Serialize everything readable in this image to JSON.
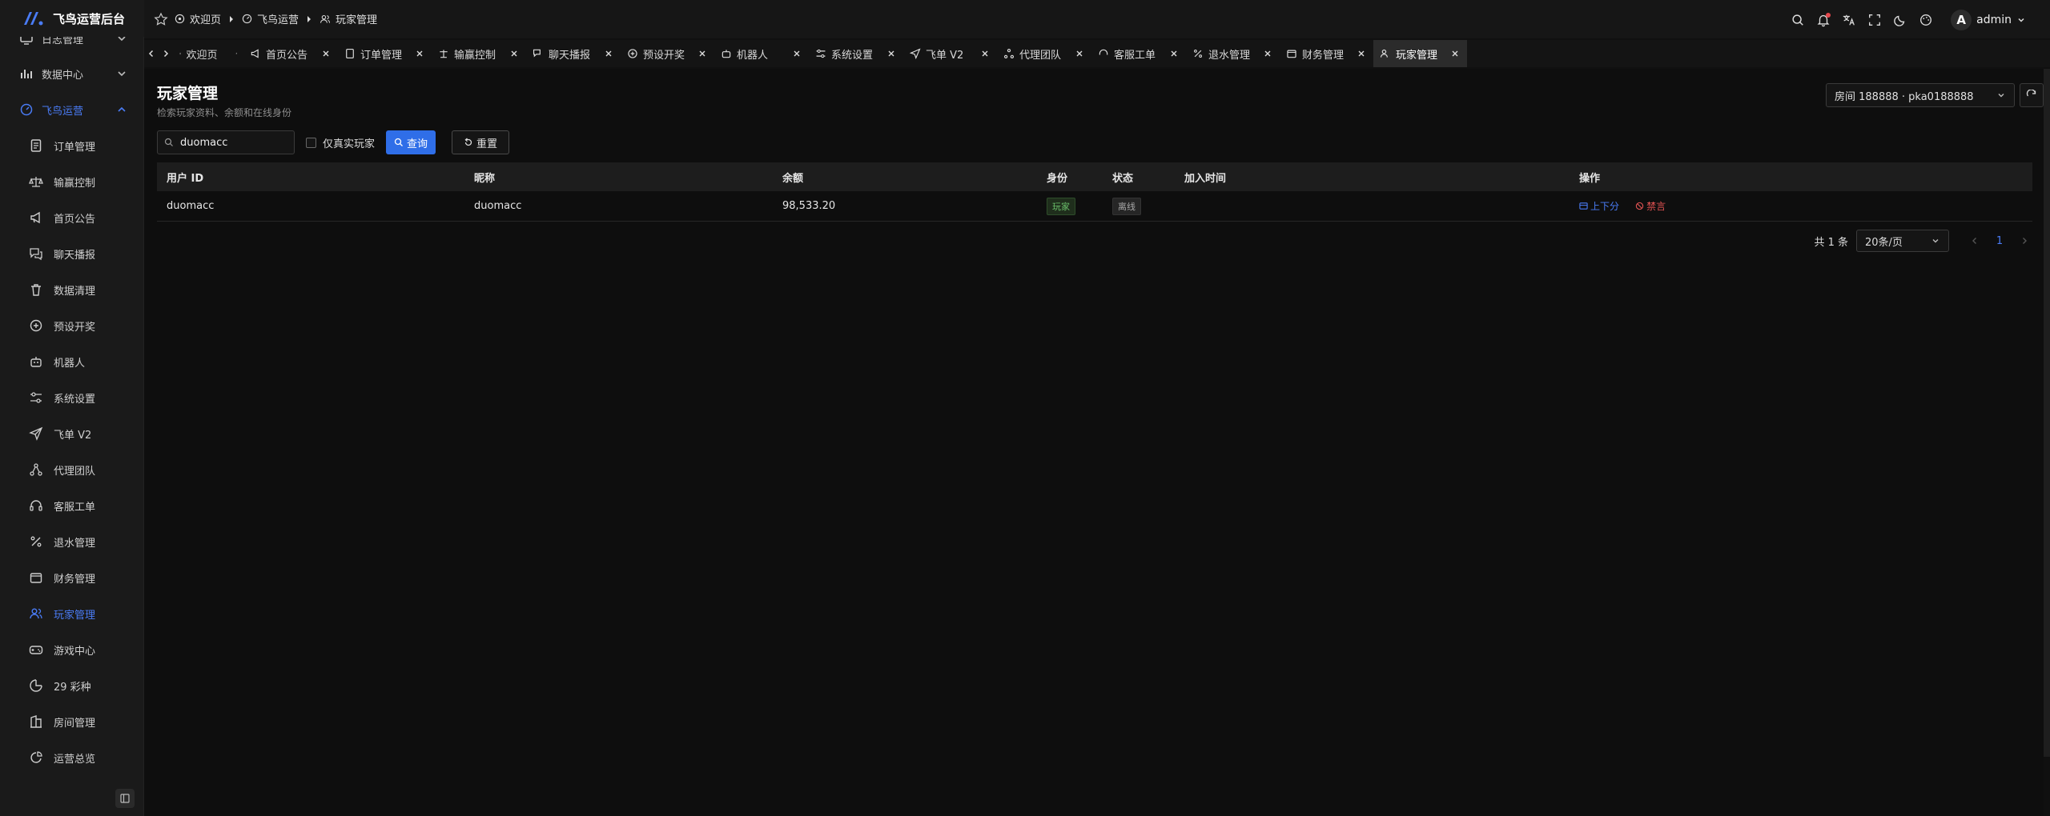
{
  "app": {
    "title": "飞鸟运营后台"
  },
  "sidebar": {
    "groups": [
      {
        "label": "日志管理",
        "icon": "monitor-icon"
      },
      {
        "label": "数据中心",
        "icon": "bar-chart-icon"
      },
      {
        "label": "飞鸟运营",
        "icon": "dashboard-icon"
      }
    ],
    "items": [
      {
        "label": "订单管理",
        "icon": "document-icon"
      },
      {
        "label": "输赢控制",
        "icon": "scale-icon"
      },
      {
        "label": "首页公告",
        "icon": "megaphone-icon"
      },
      {
        "label": "聊天播报",
        "icon": "chat-icon"
      },
      {
        "label": "数据清理",
        "icon": "trash-icon"
      },
      {
        "label": "预设开奖",
        "icon": "plus-circle-icon"
      },
      {
        "label": "机器人",
        "icon": "robot-icon"
      },
      {
        "label": "系统设置",
        "icon": "sliders-icon"
      },
      {
        "label": "飞单 V2",
        "icon": "send-icon"
      },
      {
        "label": "代理团队",
        "icon": "network-icon"
      },
      {
        "label": "客服工单",
        "icon": "headset-icon"
      },
      {
        "label": "退水管理",
        "icon": "percent-icon"
      },
      {
        "label": "财务管理",
        "icon": "wallet-icon"
      },
      {
        "label": "玩家管理",
        "icon": "users-icon"
      },
      {
        "label": "游戏中心",
        "icon": "gamepad-icon"
      },
      {
        "label": "29 彩种",
        "icon": "lottery-icon"
      },
      {
        "label": "房间管理",
        "icon": "building-icon"
      },
      {
        "label": "运营总览",
        "icon": "pie-icon"
      }
    ]
  },
  "breadcrumb": [
    "欢迎页",
    "飞鸟运营",
    "玩家管理"
  ],
  "header": {
    "user": "admin",
    "avatar_letter": "A"
  },
  "tabs": [
    {
      "label": "欢迎页",
      "icon": "home-icon"
    },
    {
      "label": "首页公告",
      "icon": "megaphone-icon"
    },
    {
      "label": "订单管理",
      "icon": "document-icon"
    },
    {
      "label": "输赢控制",
      "icon": "scale-icon"
    },
    {
      "label": "聊天播报",
      "icon": "chat-icon"
    },
    {
      "label": "预设开奖",
      "icon": "plus-circle-icon"
    },
    {
      "label": "机器人",
      "icon": "robot-icon"
    },
    {
      "label": "系统设置",
      "icon": "sliders-icon"
    },
    {
      "label": "飞单 V2",
      "icon": "send-icon"
    },
    {
      "label": "代理团队",
      "icon": "network-icon"
    },
    {
      "label": "客服工单",
      "icon": "headset-icon"
    },
    {
      "label": "退水管理",
      "icon": "percent-icon"
    },
    {
      "label": "财务管理",
      "icon": "wallet-icon"
    },
    {
      "label": "玩家管理",
      "icon": "users-icon"
    }
  ],
  "page": {
    "title": "玩家管理",
    "subtitle": "检索玩家资料、余额和在线身份",
    "room_select": "房间 188888 · pka0188888"
  },
  "filters": {
    "search_value": "duomacc",
    "real_only_label": "仅真实玩家",
    "query_label": "查询",
    "reset_label": "重置"
  },
  "table": {
    "columns": [
      "用户 ID",
      "昵称",
      "余额",
      "身份",
      "状态",
      "加入时间",
      "操作"
    ],
    "rows": [
      {
        "user_id": "duomacc",
        "nickname": "duomacc",
        "balance": "98,533.20",
        "role": "玩家",
        "status": "离线",
        "joined": "",
        "actions": [
          "上下分",
          "禁言"
        ]
      }
    ]
  },
  "pagination": {
    "total": "共 1 条",
    "page_size": "20条/页",
    "current": "1"
  },
  "colors": {
    "accent": "#2f6ee8",
    "danger": "#e05252",
    "success": "#6bc06b",
    "bg": "#101010"
  }
}
